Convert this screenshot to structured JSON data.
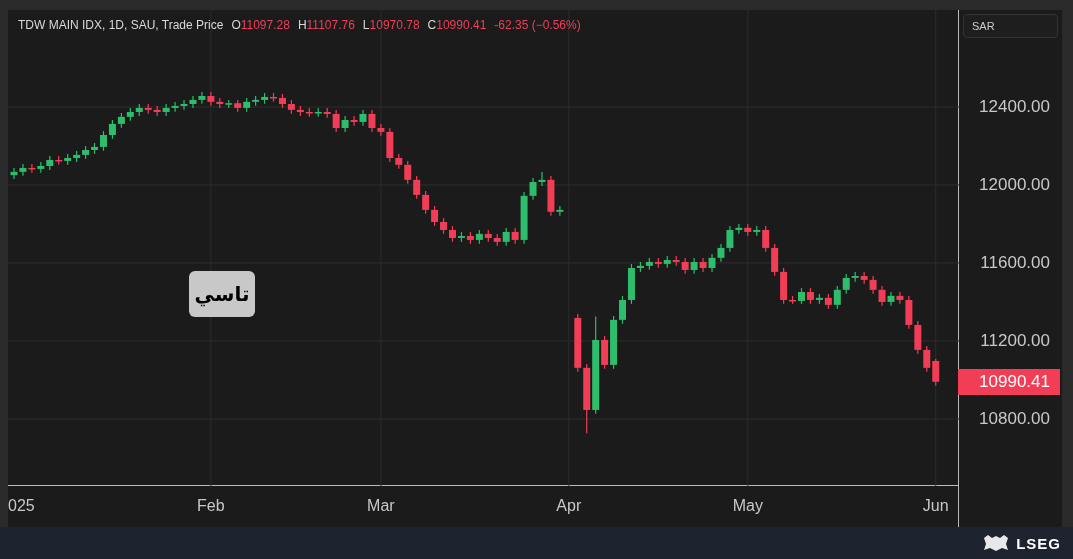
{
  "header": {
    "symbol": "TDW MAIN IDX, 1D, SAU, Trade Price",
    "ohlc": [
      {
        "label": "O",
        "value": "11097.28"
      },
      {
        "label": "H",
        "value": "11107.76"
      },
      {
        "label": "L",
        "value": "10970.78"
      },
      {
        "label": "C",
        "value": "10990.41"
      }
    ],
    "change": "-62.35 (−0.56%)"
  },
  "currency_button": "SAR",
  "chart": {
    "chart_data": {
      "type": "candlestick",
      "grid": true,
      "ylim": [
        10456,
        12897
      ],
      "categories": [
        null,
        null,
        null,
        null,
        null,
        null,
        null,
        null,
        null,
        null,
        null,
        null,
        null,
        null,
        null,
        null,
        null,
        null,
        null,
        null,
        null,
        null,
        "Feb",
        null,
        null,
        null,
        null,
        null,
        null,
        null,
        null,
        null,
        null,
        null,
        null,
        null,
        null,
        null,
        null,
        null,
        null,
        "Mar",
        null,
        null,
        null,
        null,
        null,
        null,
        null,
        null,
        null,
        null,
        null,
        null,
        null,
        null,
        null,
        null,
        null,
        null,
        null,
        null,
        "Apr",
        null,
        null,
        null,
        null,
        null,
        null,
        null,
        null,
        null,
        null,
        null,
        null,
        null,
        null,
        null,
        null,
        null,
        null,
        null,
        "May",
        null,
        null,
        null,
        null,
        null,
        null,
        null,
        null,
        null,
        null,
        null,
        null,
        null,
        null,
        null,
        null,
        null,
        null,
        null,
        null,
        "Jun"
      ],
      "ohlc": [
        [
          12050,
          12087,
          12030,
          12067
        ],
        [
          12067,
          12107,
          12047,
          12087
        ],
        [
          12087,
          12107,
          12062,
          12082
        ],
        [
          12082,
          12117,
          12062,
          12097
        ],
        [
          12097,
          12148,
          12077,
          12128
        ],
        [
          12128,
          12148,
          12103,
          12123
        ],
        [
          12123,
          12158,
          12103,
          12138
        ],
        [
          12138,
          12174,
          12118,
          12154
        ],
        [
          12154,
          12199,
          12134,
          12179
        ],
        [
          12179,
          12215,
          12159,
          12195
        ],
        [
          12195,
          12276,
          12175,
          12256
        ],
        [
          12256,
          12333,
          12236,
          12313
        ],
        [
          12313,
          12369,
          12293,
          12349
        ],
        [
          12349,
          12394,
          12329,
          12374
        ],
        [
          12374,
          12415,
          12354,
          12395
        ],
        [
          12395,
          12415,
          12365,
          12385
        ],
        [
          12385,
          12405,
          12354,
          12374
        ],
        [
          12374,
          12415,
          12354,
          12395
        ],
        [
          12395,
          12425,
          12375,
          12405
        ],
        [
          12405,
          12435,
          12385,
          12415
        ],
        [
          12415,
          12456,
          12395,
          12436
        ],
        [
          12436,
          12476,
          12416,
          12456
        ],
        [
          12456,
          12476,
          12406,
          12426
        ],
        [
          12426,
          12446,
          12395,
          12415
        ],
        [
          12415,
          12435,
          12395,
          12419
        ],
        [
          12419,
          12435,
          12375,
          12395
        ],
        [
          12395,
          12446,
          12375,
          12426
        ],
        [
          12426,
          12456,
          12406,
          12436
        ],
        [
          12436,
          12471,
          12416,
          12451
        ],
        [
          12451,
          12471,
          12426,
          12446
        ],
        [
          12446,
          12466,
          12395,
          12415
        ],
        [
          12415,
          12435,
          12365,
          12385
        ],
        [
          12385,
          12405,
          12354,
          12374
        ],
        [
          12374,
          12394,
          12349,
          12369
        ],
        [
          12369,
          12394,
          12349,
          12374
        ],
        [
          12374,
          12394,
          12344,
          12364
        ],
        [
          12364,
          12384,
          12272,
          12292
        ],
        [
          12292,
          12353,
          12272,
          12333
        ],
        [
          12333,
          12353,
          12303,
          12323
        ],
        [
          12323,
          12384,
          12303,
          12364
        ],
        [
          12364,
          12384,
          12272,
          12292
        ],
        [
          12292,
          12312,
          12252,
          12272
        ],
        [
          12272,
          12292,
          12118,
          12138
        ],
        [
          12138,
          12158,
          12083,
          12103
        ],
        [
          12103,
          12123,
          12006,
          12026
        ],
        [
          12026,
          12046,
          11929,
          11949
        ],
        [
          11949,
          11969,
          11852,
          11872
        ],
        [
          11872,
          11892,
          11790,
          11810
        ],
        [
          11810,
          11830,
          11749,
          11769
        ],
        [
          11769,
          11789,
          11708,
          11728
        ],
        [
          11728,
          11758,
          11708,
          11738
        ],
        [
          11738,
          11758,
          11698,
          11718
        ],
        [
          11718,
          11769,
          11698,
          11749
        ],
        [
          11749,
          11769,
          11708,
          11728
        ],
        [
          11728,
          11748,
          11688,
          11708
        ],
        [
          11708,
          11779,
          11688,
          11759
        ],
        [
          11759,
          11779,
          11698,
          11718
        ],
        [
          11718,
          11964,
          11698,
          11944
        ],
        [
          11944,
          12035,
          11924,
          12015
        ],
        [
          12015,
          12066,
          11995,
          12026
        ],
        [
          12026,
          12046,
          11842,
          11862
        ],
        [
          11862,
          11892,
          11842,
          11872
        ],
        null,
        [
          11318,
          11338,
          11042,
          11062
        ],
        [
          11062,
          11082,
          10726,
          10846
        ],
        [
          10846,
          11325,
          10826,
          11205
        ],
        [
          11205,
          11225,
          11057,
          11077
        ],
        [
          11077,
          11328,
          11057,
          11308
        ],
        [
          11308,
          11430,
          11288,
          11410
        ],
        [
          11410,
          11594,
          11390,
          11574
        ],
        [
          11574,
          11605,
          11554,
          11585
        ],
        [
          11585,
          11625,
          11565,
          11605
        ],
        [
          11605,
          11625,
          11575,
          11595
        ],
        [
          11595,
          11635,
          11575,
          11615
        ],
        [
          11615,
          11635,
          11585,
          11605
        ],
        [
          11605,
          11625,
          11544,
          11564
        ],
        [
          11564,
          11625,
          11544,
          11605
        ],
        [
          11605,
          11625,
          11554,
          11574
        ],
        [
          11574,
          11646,
          11554,
          11626
        ],
        [
          11626,
          11697,
          11606,
          11677
        ],
        [
          11677,
          11789,
          11657,
          11769
        ],
        [
          11769,
          11800,
          11749,
          11780
        ],
        [
          11780,
          11800,
          11739,
          11759
        ],
        [
          11759,
          11789,
          11739,
          11769
        ],
        [
          11769,
          11789,
          11657,
          11677
        ],
        [
          11677,
          11697,
          11534,
          11554
        ],
        [
          11554,
          11574,
          11390,
          11410
        ],
        [
          11410,
          11430,
          11390,
          11405
        ],
        [
          11405,
          11471,
          11390,
          11451
        ],
        [
          11451,
          11471,
          11390,
          11410
        ],
        [
          11410,
          11441,
          11390,
          11421
        ],
        [
          11421,
          11441,
          11365,
          11385
        ],
        [
          11385,
          11482,
          11365,
          11462
        ],
        [
          11462,
          11543,
          11442,
          11523
        ],
        [
          11523,
          11553,
          11503,
          11533
        ],
        [
          11533,
          11553,
          11493,
          11513
        ],
        [
          11513,
          11533,
          11442,
          11462
        ],
        [
          11462,
          11482,
          11380,
          11400
        ],
        [
          11400,
          11451,
          11380,
          11431
        ],
        [
          11431,
          11451,
          11390,
          11410
        ],
        [
          11410,
          11430,
          11262,
          11282
        ],
        [
          11282,
          11302,
          11134,
          11154
        ],
        [
          11154,
          11174,
          11042,
          11062
        ],
        [
          11097.28,
          11107.76,
          10970.78,
          10990.41
        ]
      ],
      "yticks": [
        {
          "value": 12400,
          "label": "12400.00"
        },
        {
          "value": 12000,
          "label": "12000.00"
        },
        {
          "value": 11600,
          "label": "11600.00"
        },
        {
          "value": 11200,
          "label": "11200.00"
        },
        {
          "value": 10800,
          "label": "10800.00"
        }
      ]
    }
  },
  "cut_year_label": "025",
  "last_price": "10990.41",
  "overlay_label": "تاسي",
  "footer": {
    "logo_text": "LSEG"
  }
}
